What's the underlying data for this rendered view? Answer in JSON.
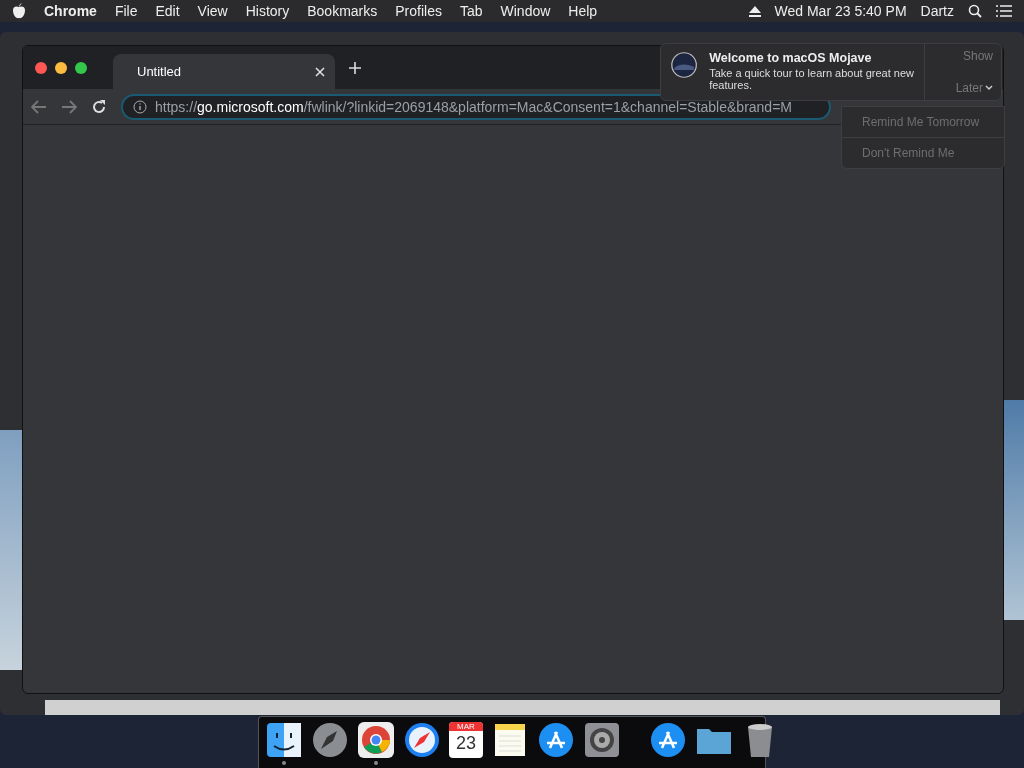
{
  "menu_bar": {
    "app": "Chrome",
    "items": [
      "File",
      "Edit",
      "View",
      "History",
      "Bookmarks",
      "Profiles",
      "Tab",
      "Window",
      "Help"
    ],
    "clock": "Wed Mar 23  5:40 PM",
    "user": "Dartz"
  },
  "browser": {
    "tabs": [
      {
        "title": "Untitled",
        "selected": true
      }
    ],
    "address": {
      "scheme": "https://",
      "host": "go.microsoft.com",
      "path": "/fwlink/?linkid=2069148&platform=Mac&Consent=1&channel=Stable&brand=M"
    }
  },
  "notification": {
    "title": "Welcome to macOS Mojave",
    "body": "Take a quick tour to learn about great new features.",
    "actions": [
      "Show",
      "Later"
    ],
    "menu": [
      "Remind Me Tomorrow",
      "Don't Remind Me"
    ]
  },
  "dock": {
    "apps": [
      {
        "kind": "finder",
        "running": true
      },
      {
        "kind": "launchpad",
        "running": false
      },
      {
        "kind": "chrome",
        "running": true
      },
      {
        "kind": "safari",
        "running": false
      },
      {
        "kind": "calendar",
        "running": false,
        "month": "MAR",
        "day": "23"
      },
      {
        "kind": "notes",
        "running": false
      },
      {
        "kind": "appstore",
        "running": false
      },
      {
        "kind": "settings",
        "running": false
      }
    ],
    "others": [
      {
        "kind": "appstore"
      },
      {
        "kind": "folder"
      },
      {
        "kind": "trash"
      }
    ]
  }
}
